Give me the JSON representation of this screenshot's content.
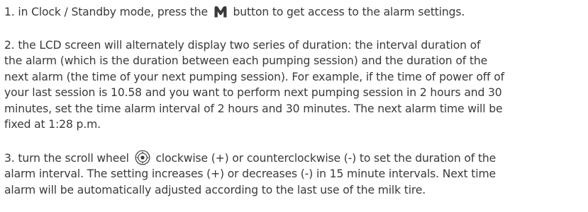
{
  "document": {
    "paragraph1": {
      "before_icon": "1. in Clock / Standby mode, press the",
      "icon": "m-logo-icon",
      "after_icon": "button to get access to the alarm settings."
    },
    "paragraph2": {
      "line1": "2. the LCD screen will alternately display two series of duration: the interval duration of",
      "line2": "the alarm (which is the duration between each pumping session) and the duration of the",
      "line3": "next alarm (the time of your next pumping session). For example, if the time of power off of",
      "line4": "your last session is 10.58 and you want to perform next pumping session in 2 hours and 30",
      "line5": "minutes, set the time alarm interval of 2 hours and 30 minutes. The next alarm time will be",
      "line6": "fixed at 1:28 p.m."
    },
    "paragraph3": {
      "before_icon": "3. turn the scroll wheel",
      "icon": "scroll-wheel-icon",
      "after_icon": "clockwise (+) or counterclockwise (-) to set the duration of the",
      "line2": "alarm interval. The setting increases (+) or decreases (-) in 15 minute intervals. Next time",
      "line3": "alarm will be automatically adjusted according to the last use of the milk tire."
    }
  }
}
